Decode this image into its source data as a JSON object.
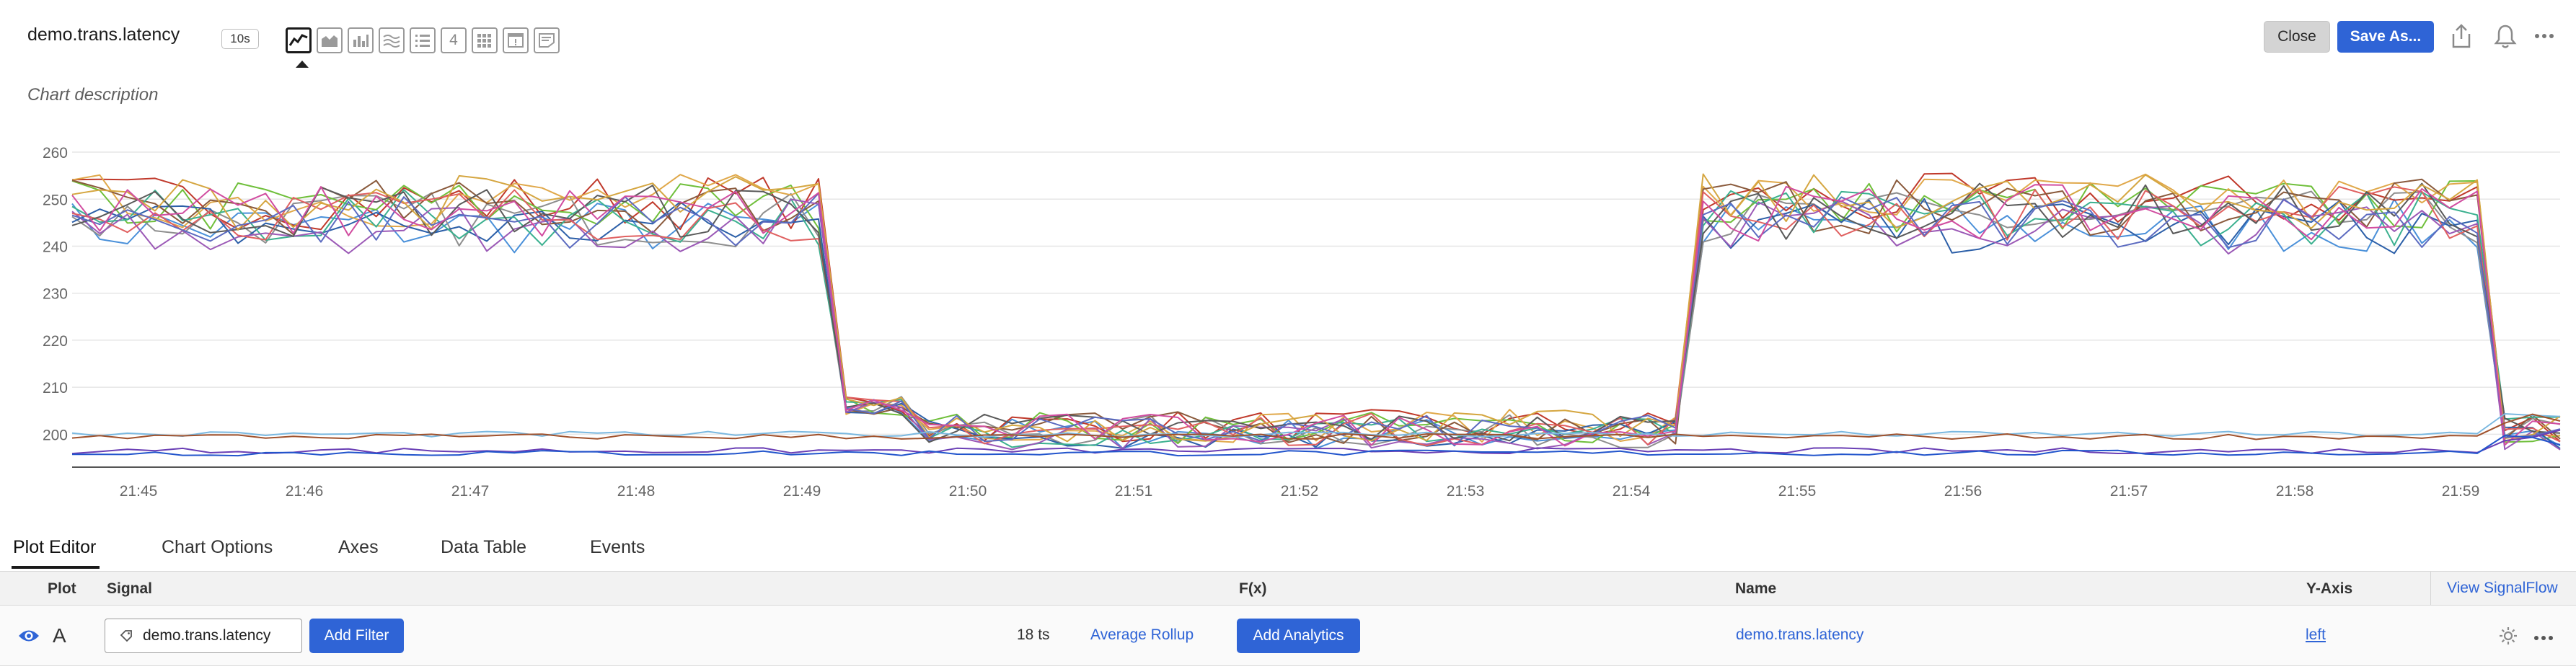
{
  "header": {
    "title": "demo.trans.latency",
    "resolution": "10s",
    "viz_number_label": "4",
    "close_label": "Close",
    "save_label": "Save As...",
    "description": "Chart description"
  },
  "tabs": [
    {
      "label": "Plot Editor"
    },
    {
      "label": "Chart Options"
    },
    {
      "label": "Axes"
    },
    {
      "label": "Data Table"
    },
    {
      "label": "Events"
    }
  ],
  "table": {
    "headers": {
      "plot": "Plot",
      "signal": "Signal",
      "fx": "F(x)",
      "name": "Name",
      "yaxis": "Y-Axis"
    },
    "view_signalflow": "View SignalFlow",
    "row": {
      "letter": "A",
      "signal": "demo.trans.latency",
      "add_filter": "Add Filter",
      "ts_count": "18 ts",
      "rollup": "Average Rollup",
      "add_analytics": "Add Analytics",
      "name": "demo.trans.latency",
      "yaxis": "left"
    }
  },
  "colors": {
    "accent": "#2f64d6",
    "series": [
      "#4a90d9",
      "#c0392b",
      "#8e8e8e",
      "#6fbf3a",
      "#e0a84a",
      "#2c5fa8",
      "#8a5a3c",
      "#3bb08f",
      "#9b59b6",
      "#e06060",
      "#5a5a5a",
      "#d5a640",
      "#5c6bc0",
      "#d14da0",
      "#6a3fb5",
      "#2255cc",
      "#7ab8e0",
      "#a0522d"
    ]
  },
  "chart_data": {
    "type": "line",
    "x": [
      "21:45",
      "21:46",
      "21:47",
      "21:48",
      "21:49",
      "21:50",
      "21:51",
      "21:52",
      "21:53",
      "21:54",
      "21:55",
      "21:56",
      "21:57",
      "21:58",
      "21:59"
    ],
    "yticks": [
      200,
      210,
      220,
      230,
      240,
      250,
      260
    ],
    "ylim": [
      193,
      262
    ],
    "grid": true,
    "segments_high": [
      {
        "from": "21:44.6",
        "to": "21:49.1",
        "level": 247
      },
      {
        "from": "21:54.4",
        "to": "21:59.1",
        "level": 247
      }
    ],
    "segments_low_level": 201,
    "baseline_levels": [
      200,
      199.5,
      196.5,
      196
    ],
    "series_count": 18
  }
}
